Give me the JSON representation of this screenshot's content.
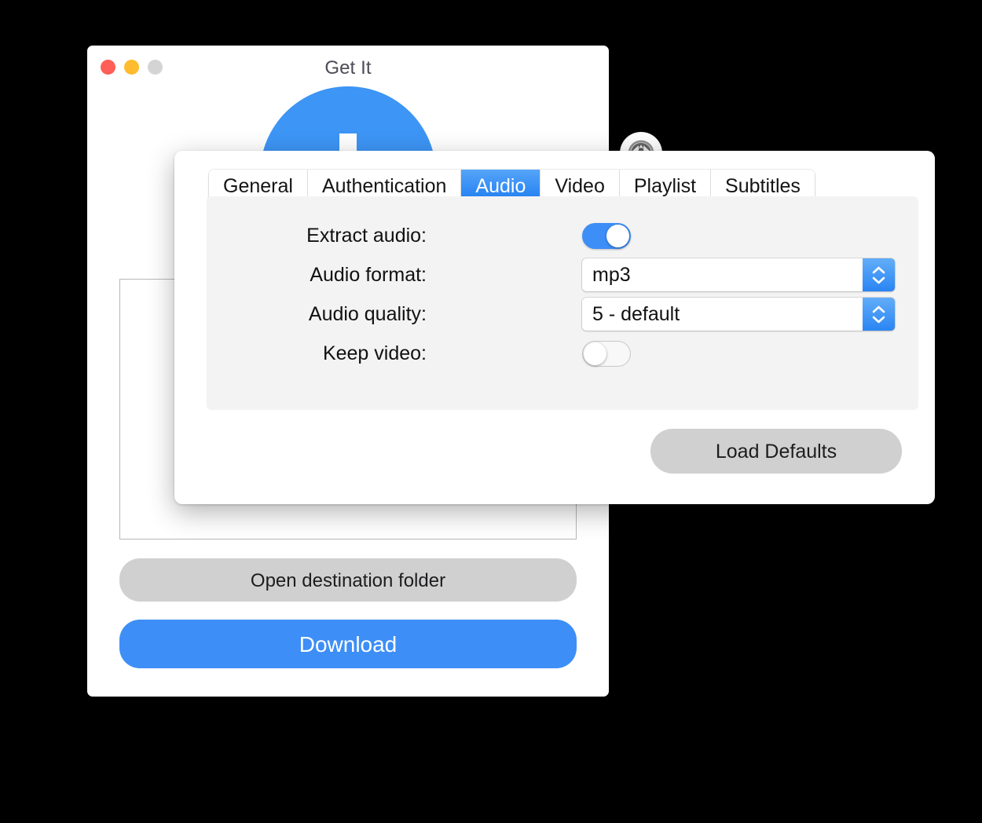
{
  "window": {
    "title": "Get It",
    "traffic_lights": [
      {
        "name": "close",
        "color": "#ff5f56"
      },
      {
        "name": "minimize",
        "color": "#febc2e"
      },
      {
        "name": "zoom",
        "color": "#d4d4d4"
      }
    ],
    "logo_icon": "download-circle-icon",
    "accent_color": "#3d8ef7"
  },
  "main": {
    "file_list_value": "",
    "open_folder_label": "Open destination folder",
    "download_label": "Download"
  },
  "settings_button": {
    "icon": "gear-icon",
    "label": "Settings"
  },
  "popover": {
    "tabs": [
      {
        "label": "General",
        "active": false
      },
      {
        "label": "Authentication",
        "active": false
      },
      {
        "label": "Audio",
        "active": true
      },
      {
        "label": "Video",
        "active": false
      },
      {
        "label": "Playlist",
        "active": false
      },
      {
        "label": "Subtitles",
        "active": false
      }
    ],
    "active_tab": "Audio",
    "active_tab_color": "#1e7df1",
    "fields": [
      {
        "label": "Extract audio:",
        "type": "switch",
        "value": "on"
      },
      {
        "label": "Audio format:",
        "type": "combo",
        "value": "mp3"
      },
      {
        "label": "Audio quality:",
        "type": "combo",
        "value": "5 - default"
      },
      {
        "label": "Keep video:",
        "type": "switch",
        "value": "off"
      }
    ],
    "load_defaults_label": "Load Defaults"
  }
}
